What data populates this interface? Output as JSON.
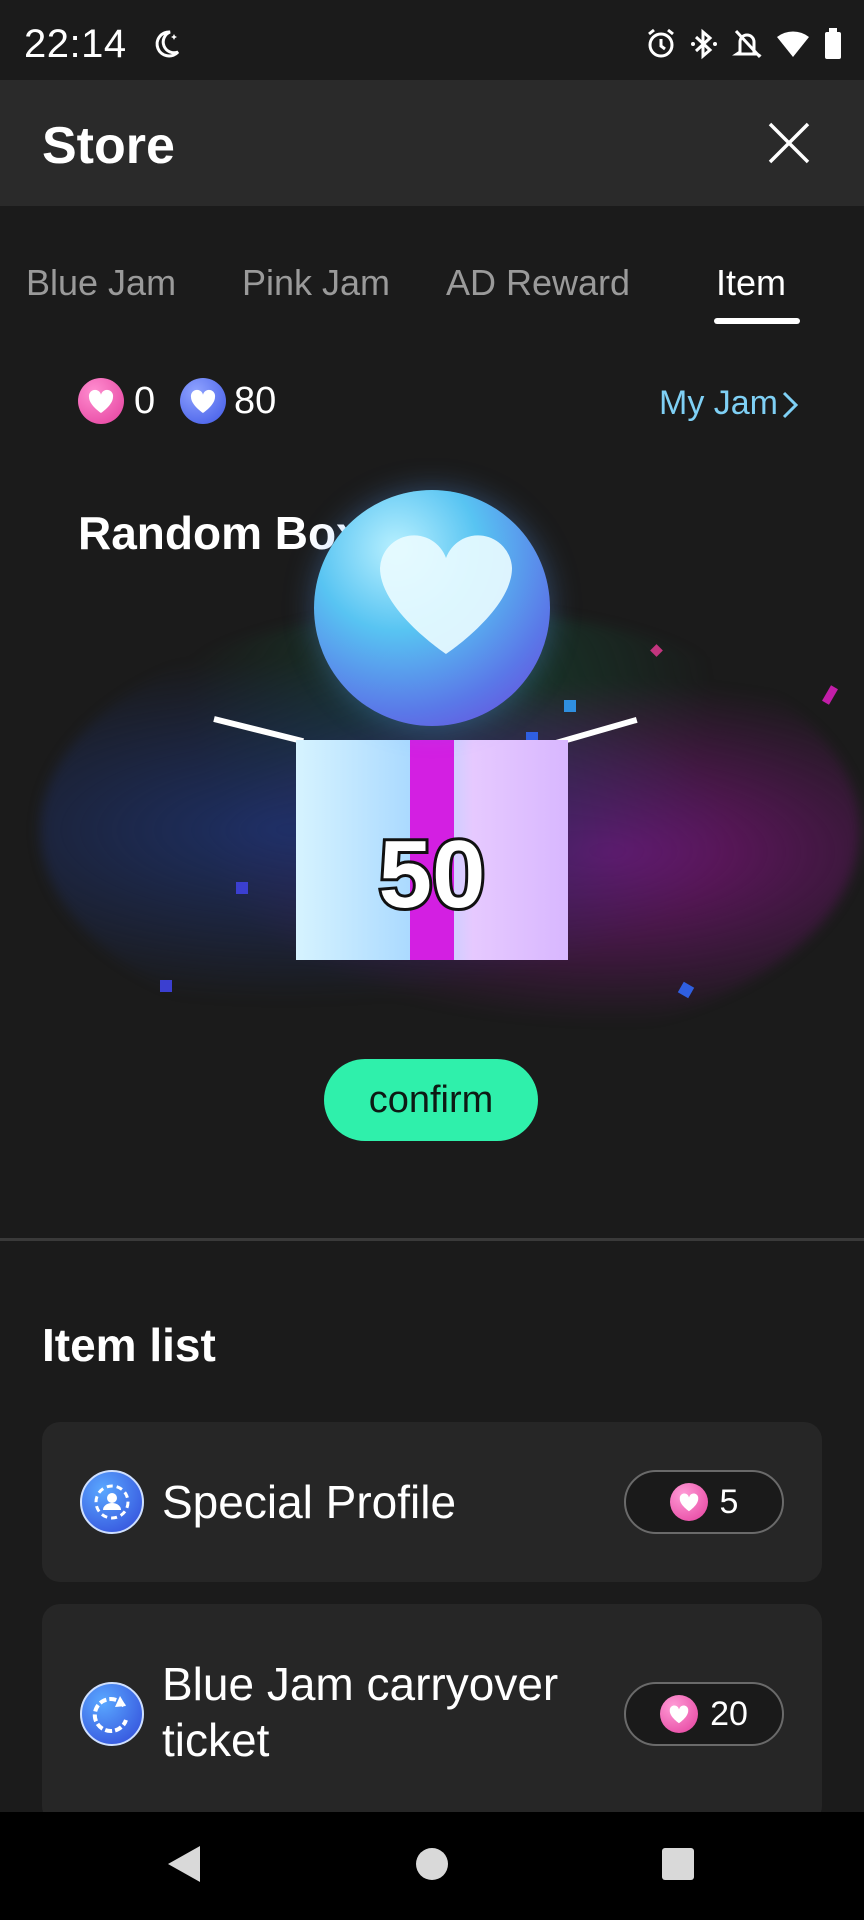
{
  "status_bar": {
    "time": "22:14",
    "icons": [
      "moon-icon",
      "alarm-icon",
      "bluetooth-icon",
      "silent-bell-icon",
      "wifi-icon",
      "battery-icon"
    ]
  },
  "header": {
    "title": "Store",
    "close_icon": "close-icon"
  },
  "tabs": [
    {
      "label": "Blue Jam",
      "active": false
    },
    {
      "label": "Pink Jam",
      "active": false
    },
    {
      "label": "AD Reward",
      "active": false
    },
    {
      "label": "Item",
      "active": true
    }
  ],
  "balance": {
    "pink_jam": "0",
    "blue_jam": "80",
    "my_jam_link": "My Jam"
  },
  "random_box": {
    "title": "Random Box",
    "count": "50",
    "confirm_label": "confirm"
  },
  "item_list": {
    "title": "Item list",
    "items": [
      {
        "name": "Special Profile",
        "price": "5",
        "icon": "profile-badge-icon"
      },
      {
        "name": "Blue Jam carryover ticket",
        "price": "20",
        "icon": "carryover-icon"
      }
    ]
  },
  "colors": {
    "accent_green": "#2ff0ab",
    "pink_jam": "#e43e9d",
    "blue_jam": "#3f58e6",
    "link_blue": "#7fd0f5",
    "background": "#1b1b1b"
  }
}
